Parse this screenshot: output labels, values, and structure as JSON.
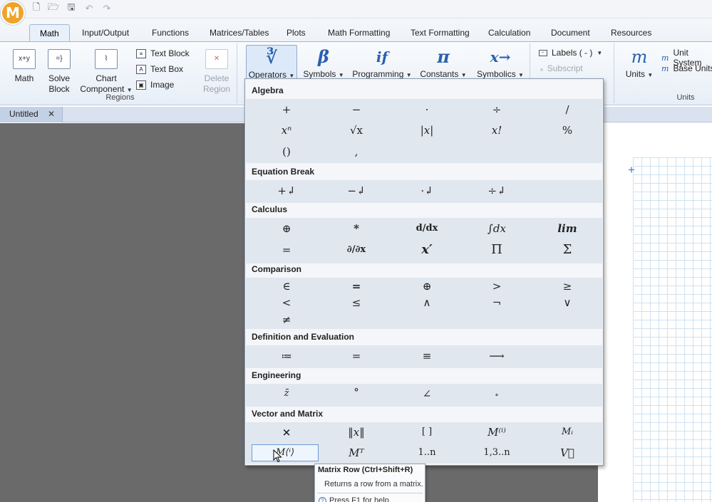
{
  "quick_access": {
    "icons": [
      "new-document-icon",
      "open-folder-icon",
      "save-icon",
      "undo-icon",
      "redo-icon"
    ]
  },
  "tabs": [
    "Math",
    "Input/Output",
    "Functions",
    "Matrices/Tables",
    "Plots",
    "Math Formatting",
    "Text Formatting",
    "Calculation",
    "Document",
    "Resources"
  ],
  "ribbon": {
    "regions": {
      "label": "Regions",
      "math": "Math",
      "solve_block": [
        "Solve",
        "Block"
      ],
      "chart_component": [
        "Chart",
        "Component"
      ],
      "text_block": "Text Block",
      "text_box": "Text Box",
      "image": "Image",
      "delete_region": [
        "Delete",
        "Region"
      ]
    },
    "operators_group": {
      "operators": "Operators",
      "symbols": "Symbols",
      "programming": "Programming",
      "constants": "Constants",
      "symbolics": "Symbolics",
      "sym_operators": "∛",
      "sym_symbols": "β",
      "sym_programming": "if",
      "sym_constants": "π",
      "sym_symbolics": "x→"
    },
    "labels_group": {
      "labels": "Labels  ( - )",
      "subscript": "Subscript"
    },
    "units": {
      "label": "Units",
      "units_btn": "Units",
      "units_sym": "m",
      "unit_system": "Unit System",
      "base_units": "Base Units"
    }
  },
  "document_tab": {
    "name": "Untitled",
    "close": "✕"
  },
  "operators_panel": {
    "sections": {
      "algebra": "Algebra",
      "equation_break": "Equation Break",
      "calculus": "Calculus",
      "comparison": "Comparison",
      "definition": "Definition and Evaluation",
      "engineering": "Engineering",
      "vector_matrix": "Vector and Matrix"
    },
    "algebra": {
      "r1": [
        "+",
        "−",
        "·",
        "÷",
        "/"
      ],
      "r2": [
        "xⁿ",
        "√x",
        "|x|",
        "x!",
        "%"
      ],
      "r3": [
        "()",
        ","
      ]
    },
    "equation_break": [
      "+↲",
      "−↲",
      "·↲",
      "÷↲"
    ],
    "calculus": {
      "r1": [
        "⊕",
        "*",
        "d/dx",
        "∫dx",
        "lim"
      ],
      "r2": [
        "=",
        "∂/∂x",
        "x′",
        "Π",
        "Σ"
      ]
    },
    "comparison": {
      "r1": [
        "∈",
        "=",
        "⊕",
        ">",
        "≥"
      ],
      "r2": [
        "<",
        "≤",
        "∧",
        "¬",
        "∨"
      ],
      "r3": [
        "≠"
      ]
    },
    "definition": [
      "≔",
      "=",
      "≡",
      "⟶"
    ],
    "engineering": [
      "z̄",
      "°",
      "∠",
      "∘"
    ],
    "vector_matrix": {
      "r1": [
        "×",
        "‖x‖",
        "[ ]",
        "M⁽ⁱ⁾",
        "Mᵢ"
      ],
      "r2": [
        "M⟨ⁱ⟩",
        "Mᵀ",
        "1..n",
        "1,3..n",
        "V⃗"
      ]
    }
  },
  "tooltip": {
    "title": "Matrix Row (Ctrl+Shift+R)",
    "description": "Returns a row from a matrix.",
    "help": "Press F1 for help."
  }
}
